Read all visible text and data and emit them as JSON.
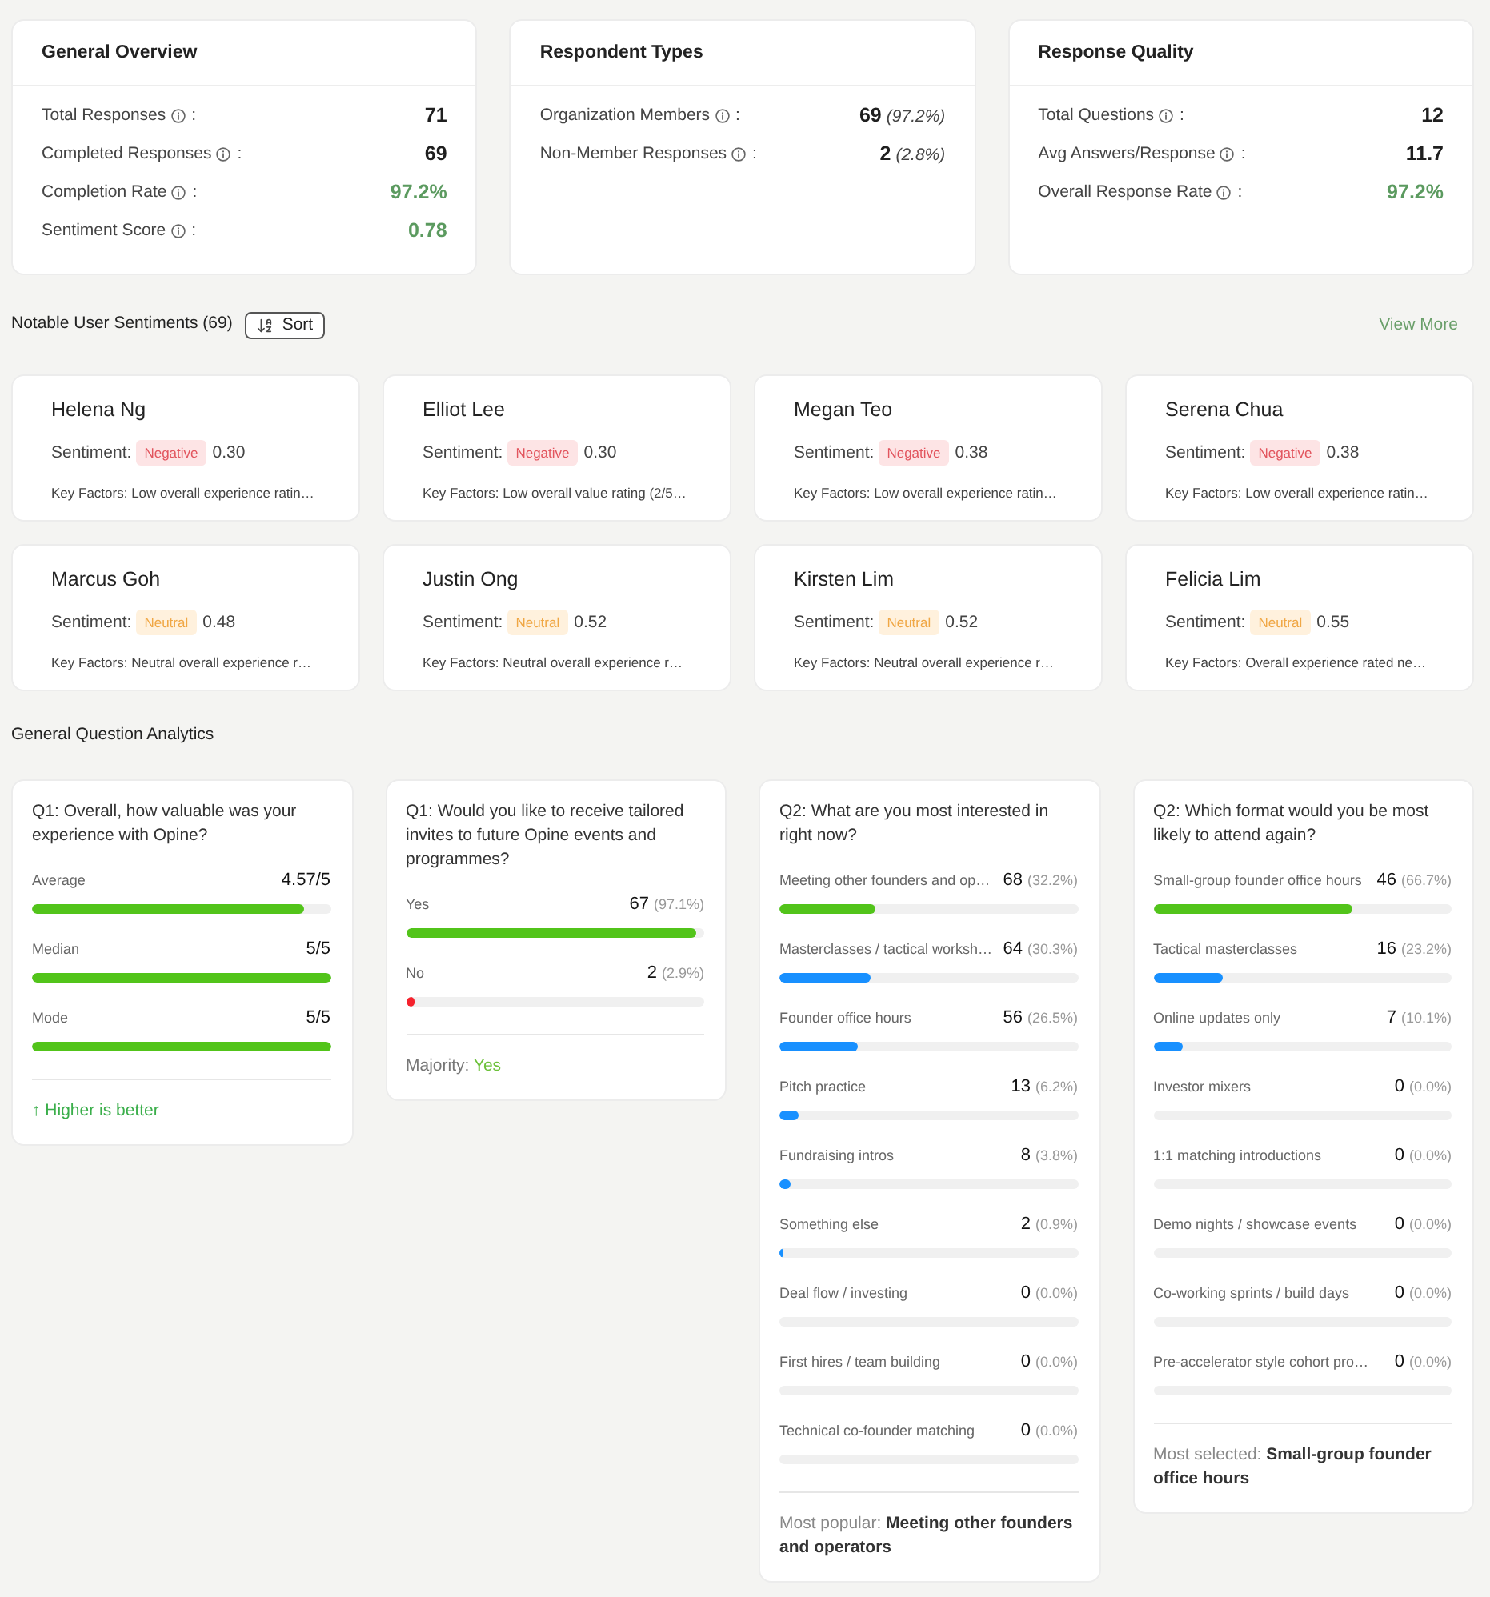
{
  "overview_cards": [
    {
      "title": "General Overview",
      "rows": [
        {
          "label": "Total Responses",
          "suffix": ":",
          "value": "71",
          "positive": false
        },
        {
          "label": "Completed Responses",
          "suffix": ":",
          "value": "69",
          "positive": false
        },
        {
          "label": "Completion Rate",
          "suffix": ":",
          "value": "97.2%",
          "positive": true
        },
        {
          "label": "Sentiment Score",
          "suffix": ":",
          "value": "0.78",
          "positive": true
        }
      ]
    },
    {
      "title": "Respondent Types",
      "rows": [
        {
          "label": "Organization Members",
          "suffix": ":",
          "value": "69",
          "note": "(97.2%)",
          "positive": false
        },
        {
          "label": "Non-Member Responses",
          "suffix": ":",
          "value": "2",
          "note": "(2.8%)",
          "positive": false
        }
      ]
    },
    {
      "title": "Response Quality",
      "rows": [
        {
          "label": "Total Questions",
          "suffix": ":",
          "value": "12",
          "positive": false
        },
        {
          "label": "Avg Answers/Response",
          "suffix": ":",
          "value": "11.7",
          "positive": false
        },
        {
          "label": "Overall Response Rate",
          "suffix": ":",
          "value": "97.2%",
          "positive": true
        }
      ]
    }
  ],
  "sentiments": {
    "title": "Notable User Sentiments (69)",
    "sort_button": "Sort",
    "view_more": "View More",
    "cards": [
      {
        "name": "Helena Ng",
        "score_label": "Sentiment:",
        "badge": {
          "label": "Negative",
          "kind": "negative"
        },
        "score": "0.30",
        "key_factors": "Key Factors: Low overall experience ratin…"
      },
      {
        "name": "Elliot Lee",
        "score_label": "Sentiment:",
        "badge": {
          "label": "Negative",
          "kind": "negative"
        },
        "score": "0.30",
        "key_factors": "Key Factors: Low overall value rating (2/5…"
      },
      {
        "name": "Megan Teo",
        "score_label": "Sentiment:",
        "badge": {
          "label": "Negative",
          "kind": "negative"
        },
        "score": "0.38",
        "key_factors": "Key Factors: Low overall experience ratin…"
      },
      {
        "name": "Serena Chua",
        "score_label": "Sentiment:",
        "badge": {
          "label": "Negative",
          "kind": "negative"
        },
        "score": "0.38",
        "key_factors": "Key Factors: Low overall experience ratin…"
      },
      {
        "name": "Marcus Goh",
        "score_label": "Sentiment:",
        "badge": {
          "label": "Neutral",
          "kind": "neutral"
        },
        "score": "0.48",
        "key_factors": "Key Factors: Neutral overall experience r…"
      },
      {
        "name": "Justin Ong",
        "score_label": "Sentiment:",
        "badge": {
          "label": "Neutral",
          "kind": "neutral"
        },
        "score": "0.52",
        "key_factors": "Key Factors: Neutral overall experience r…"
      },
      {
        "name": "Kirsten Lim",
        "score_label": "Sentiment:",
        "badge": {
          "label": "Neutral",
          "kind": "neutral"
        },
        "score": "0.52",
        "key_factors": "Key Factors: Neutral overall experience r…"
      },
      {
        "name": "Felicia Lim",
        "score_label": "Sentiment:",
        "badge": {
          "label": "Neutral",
          "kind": "neutral"
        },
        "score": "0.55",
        "key_factors": "Key Factors: Overall experience rated ne…"
      }
    ]
  },
  "analytics": {
    "title": "General Question Analytics",
    "questions": [
      {
        "title": "Q1: Overall, how valuable was your experience with Opine?",
        "options": [
          {
            "label": "Average",
            "count": "4.57/5",
            "level": 0.914,
            "color": "#52c41a"
          },
          {
            "label": "Median",
            "count": "5/5",
            "level": 1,
            "color": "#52c41a"
          },
          {
            "label": "Mode",
            "count": "5/5",
            "level": 1,
            "color": "#52c41a"
          }
        ],
        "footer": {
          "kind": "note",
          "label": "↑ Higher is better"
        }
      },
      {
        "title": "Q1: Would you like to receive tailored invites to future Opine events and programmes?",
        "options": [
          {
            "label": "Yes",
            "count": "67",
            "percent": "(97.1%)",
            "level": 0.971,
            "color": "#52c41a"
          },
          {
            "label": "No",
            "count": "2",
            "percent": "(2.9%)",
            "level": 0.029,
            "color": "#f5222d"
          }
        ],
        "footer": {
          "kind": "majority",
          "label": "Majority:",
          "value": "Yes"
        }
      },
      {
        "title": "Q2: What are you most interested in right now?",
        "options": [
          {
            "label": "Meeting other founders and op…",
            "count": "68",
            "percent": "(32.2%)",
            "level": 0.322,
            "color": "#52c41a"
          },
          {
            "label": "Masterclasses / tactical worksh…",
            "count": "64",
            "percent": "(30.3%)",
            "level": 0.303,
            "color": "#1890ff"
          },
          {
            "label": "Founder office hours",
            "count": "56",
            "percent": "(26.5%)",
            "level": 0.265,
            "color": "#1890ff"
          },
          {
            "label": "Pitch practice",
            "count": "13",
            "percent": "(6.2%)",
            "level": 0.062,
            "color": "#1890ff"
          },
          {
            "label": "Fundraising intros",
            "count": "8",
            "percent": "(3.8%)",
            "level": 0.038,
            "color": "#1890ff"
          },
          {
            "label": "Something else",
            "count": "2",
            "percent": "(0.9%)",
            "level": 0.009,
            "color": "#1890ff"
          },
          {
            "label": "Deal flow / investing",
            "count": "0",
            "percent": "(0.0%)",
            "level": 0
          },
          {
            "label": "First hires / team building",
            "count": "0",
            "percent": "(0.0%)",
            "level": 0
          },
          {
            "label": "Technical co-founder matching",
            "count": "0",
            "percent": "(0.0%)",
            "level": 0
          }
        ],
        "footer": {
          "kind": "summary",
          "label": "Most popular:",
          "value": "Meeting other founders and operators"
        }
      },
      {
        "title": "Q2: Which format would you be most likely to attend again?",
        "options": [
          {
            "label": "Small-group founder office hours",
            "count": "46",
            "percent": "(66.7%)",
            "level": 0.667,
            "color": "#52c41a"
          },
          {
            "label": "Tactical masterclasses",
            "count": "16",
            "percent": "(23.2%)",
            "level": 0.232,
            "color": "#1890ff"
          },
          {
            "label": "Online updates only",
            "count": "7",
            "percent": "(10.1%)",
            "level": 0.101,
            "color": "#1890ff"
          },
          {
            "label": "Investor mixers",
            "count": "0",
            "percent": "(0.0%)",
            "level": 0
          },
          {
            "label": "1:1 matching introductions",
            "count": "0",
            "percent": "(0.0%)",
            "level": 0
          },
          {
            "label": "Demo nights / showcase events",
            "count": "0",
            "percent": "(0.0%)",
            "level": 0
          },
          {
            "label": "Co-working sprints / build days",
            "count": "0",
            "percent": "(0.0%)",
            "level": 0
          },
          {
            "label": "Pre-accelerator style cohort pro…",
            "count": "0",
            "percent": "(0.0%)",
            "level": 0
          }
        ],
        "footer": {
          "kind": "summary",
          "label": "Most selected:",
          "value": "Small-group founder office hours"
        }
      }
    ]
  }
}
